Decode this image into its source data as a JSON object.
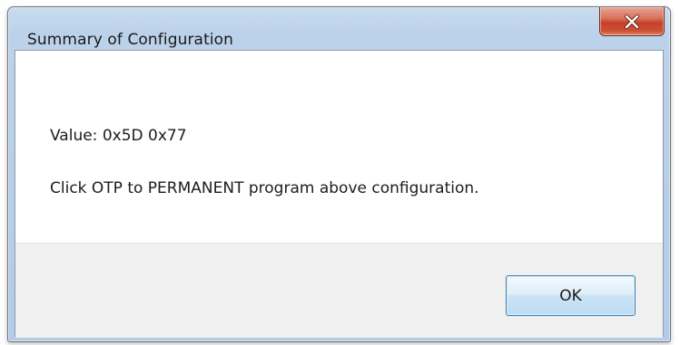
{
  "window": {
    "title": "Summary of Configuration"
  },
  "message": {
    "value_line": "Value: 0x5D 0x77",
    "instruction_line": "Click OTP to PERMANENT program above configuration."
  },
  "buttons": {
    "ok_label": "OK",
    "close_icon": "close-x-icon"
  },
  "colors": {
    "titlebar": "#b9d0e9",
    "close_button": "#c9452c",
    "footer": "#f0f0f0",
    "ok_border": "#3c7fb1"
  }
}
